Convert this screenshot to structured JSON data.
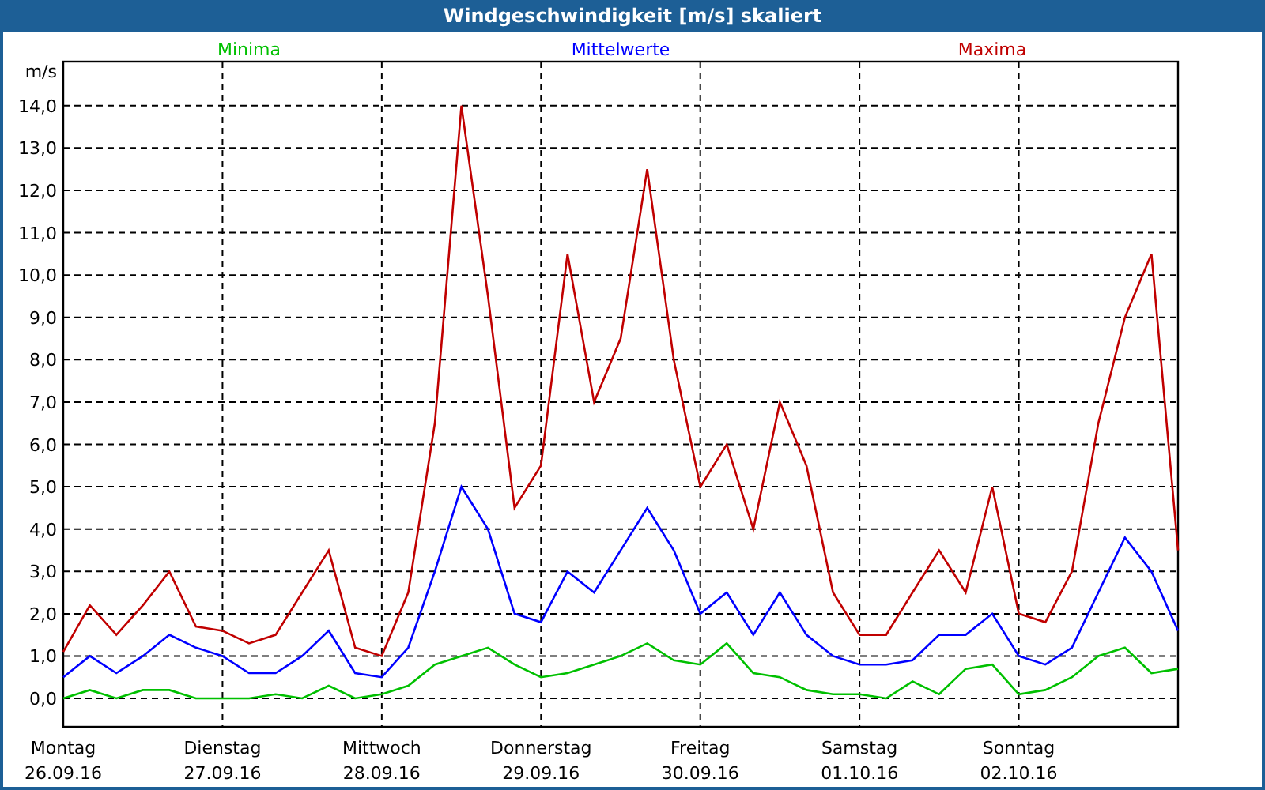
{
  "window": {
    "title": "Windgeschwindigkeit [m/s] skaliert"
  },
  "chart": {
    "chart_data": {
      "type": "line",
      "ylabel": "m/s",
      "categories": [
        "Montag",
        null,
        null,
        null,
        null,
        null,
        "Dienstag",
        null,
        null,
        null,
        null,
        null,
        "Mittwoch",
        null,
        null,
        null,
        null,
        null,
        "Donnerstag",
        null,
        null,
        null,
        null,
        null,
        "Freitag",
        null,
        null,
        null,
        null,
        null,
        "Samstag",
        null,
        null,
        null,
        null,
        null,
        "Sonntag",
        null,
        null,
        null,
        null,
        null,
        null
      ],
      "ylim": [
        -0.67,
        15.04
      ],
      "grid": true,
      "yticks": [
        {
          "value": 0,
          "label": "0,0"
        },
        {
          "value": 1,
          "label": "1,0"
        },
        {
          "value": 2,
          "label": "2,0"
        },
        {
          "value": 3,
          "label": "3,0"
        },
        {
          "value": 4,
          "label": "4,0"
        },
        {
          "value": 5,
          "label": "5,0"
        },
        {
          "value": 6,
          "label": "6,0"
        },
        {
          "value": 7,
          "label": "7,0"
        },
        {
          "value": 8,
          "label": "8,0"
        },
        {
          "value": 9,
          "label": "9,0"
        },
        {
          "value": 10,
          "label": "10,0"
        },
        {
          "value": 11,
          "label": "11,0"
        },
        {
          "value": 12,
          "label": "12,0"
        },
        {
          "value": 13,
          "label": "13,0"
        },
        {
          "value": 14,
          "label": "14,0"
        }
      ],
      "series": [
        {
          "name": "Minima",
          "color": "#00c000",
          "values": [
            0,
            0.2,
            0,
            0.2,
            0.2,
            0,
            0,
            0,
            0.1,
            0,
            0.3,
            0,
            0.1,
            0.3,
            0.8,
            1.0,
            1.2,
            0.8,
            0.5,
            0.6,
            0.8,
            1.0,
            1.3,
            0.9,
            0.8,
            1.3,
            0.6,
            0.5,
            0.2,
            0.1,
            0.1,
            0,
            0.4,
            0.1,
            0.7,
            0.8,
            0.1,
            0.2,
            0.5,
            1.0,
            1.2,
            0.6,
            0.7
          ]
        },
        {
          "name": "Mittelwerte",
          "color": "#0000ff",
          "values": [
            0.5,
            1.0,
            0.6,
            1.0,
            1.5,
            1.2,
            1.0,
            0.6,
            0.6,
            1.0,
            1.6,
            0.6,
            0.5,
            1.2,
            3.0,
            5.0,
            4.0,
            2.0,
            1.8,
            3.0,
            2.5,
            3.5,
            4.5,
            3.5,
            2.0,
            2.5,
            1.5,
            2.5,
            1.5,
            1.0,
            0.8,
            0.8,
            0.9,
            1.5,
            1.5,
            2.0,
            1.0,
            0.8,
            1.2,
            2.5,
            3.8,
            3.0,
            1.6
          ]
        },
        {
          "name": "Maxima",
          "color": "#c00000",
          "values": [
            1.1,
            2.2,
            1.5,
            2.2,
            3.0,
            1.7,
            1.6,
            1.3,
            1.5,
            2.5,
            3.5,
            1.2,
            1.0,
            2.5,
            6.5,
            14.0,
            9.5,
            4.5,
            5.5,
            10.5,
            7.0,
            8.5,
            12.5,
            8.0,
            5.0,
            6.0,
            4.0,
            7.0,
            5.5,
            2.5,
            1.5,
            1.5,
            2.5,
            3.5,
            2.5,
            5.0,
            2.0,
            1.8,
            3.0,
            6.5,
            9.0,
            10.5,
            3.5
          ]
        }
      ]
    },
    "dates": [
      "26.09.16",
      "27.09.16",
      "28.09.16",
      "29.09.16",
      "30.09.16",
      "01.10.16",
      "02.10.16"
    ]
  }
}
